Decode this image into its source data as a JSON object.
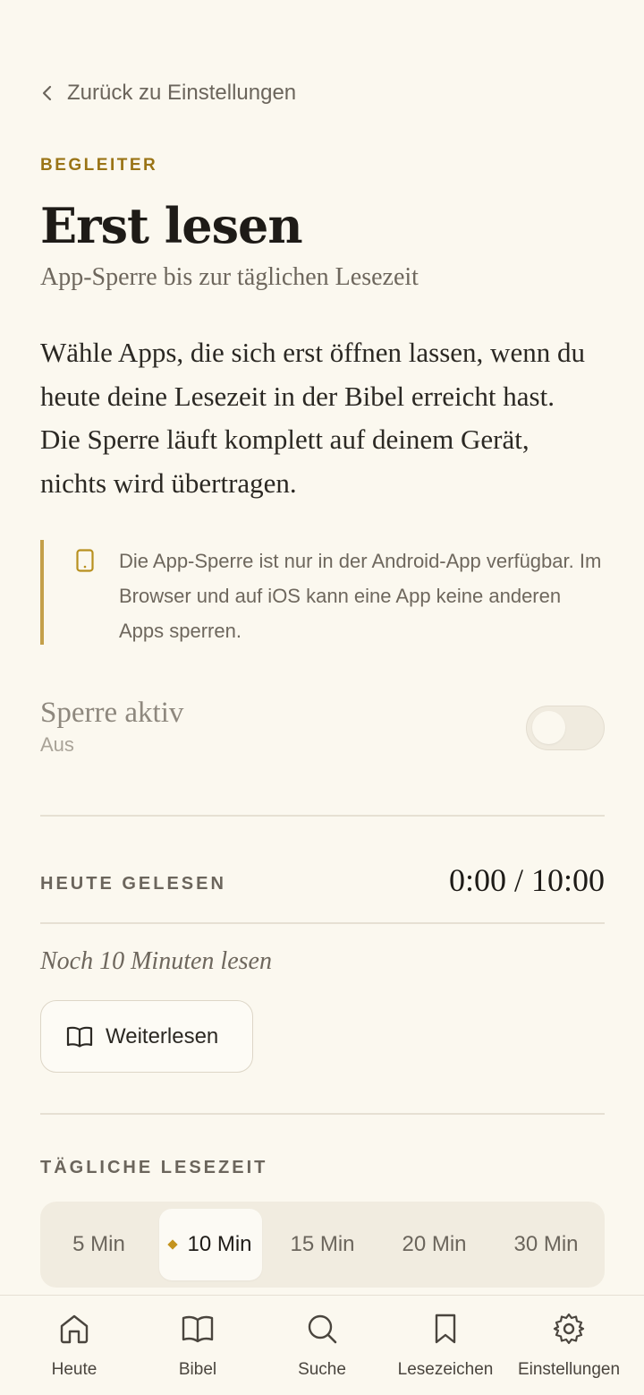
{
  "back_link": {
    "label": "Zurück zu Einstellungen"
  },
  "header": {
    "eyebrow": "BEGLEITER",
    "title": "Erst lesen",
    "subtitle": "App-Sperre bis zur täglichen Lesezeit"
  },
  "intro": "Wähle Apps, die sich erst öffnen lassen, wenn du heute deine Lesezeit in der Bibel erreicht hast. Die Sperre läuft komplett auf deinem Gerät, nichts wird übertragen.",
  "notice": {
    "icon": "phone-icon",
    "text": "Die App-Sperre ist nur in der Android-App verfügbar. Im Browser und auf iOS kann eine App keine anderen Apps sperren."
  },
  "lock_toggle": {
    "title": "Sperre aktiv",
    "state_label": "Aus",
    "enabled": false
  },
  "today": {
    "label": "HEUTE GELESEN",
    "value": "0:00 / 10:00",
    "remaining": "Noch 10 Minuten lesen",
    "continue_button": "Weiterlesen",
    "continue_icon": "book-icon"
  },
  "daily_time": {
    "label": "TÄGLICHE LESEZEIT",
    "options": [
      "5 Min",
      "10 Min",
      "15 Min",
      "20 Min",
      "30 Min"
    ],
    "selected_index": 1,
    "accent_color": "#c4931e"
  },
  "bottom_nav": {
    "items": [
      {
        "label": "Heute",
        "icon": "home-icon"
      },
      {
        "label": "Bibel",
        "icon": "book-icon"
      },
      {
        "label": "Suche",
        "icon": "search-icon"
      },
      {
        "label": "Lesezeichen",
        "icon": "bookmark-icon"
      },
      {
        "label": "Einstellungen",
        "icon": "gear-icon"
      }
    ]
  },
  "colors": {
    "background": "#fbf8ef",
    "accent": "#9a7416",
    "notice_border": "#c4a04a"
  }
}
